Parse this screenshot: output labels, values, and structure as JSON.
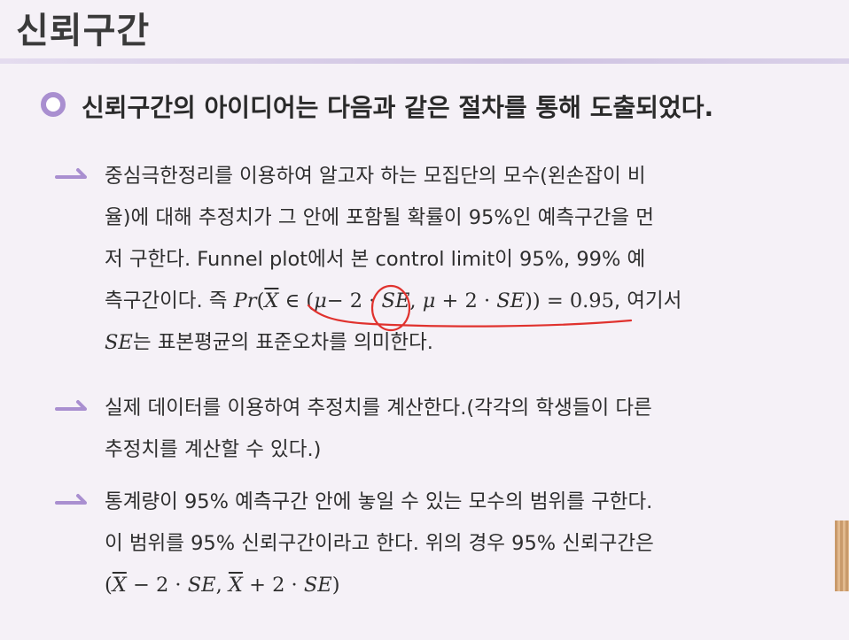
{
  "title": "신뢰구간",
  "heading": "신뢰구간의 아이디어는 다음과 같은 절차를 통해 도출되었다.",
  "items": [
    {
      "line1": "중심극한정리를 이용하여 알고자 하는 모집단의 모수(왼손잡이 비",
      "line2": "율)에 대해 추정치가 그 안에 포함될 확률이 95%인 예측구간을 먼",
      "line3": "저 구한다. Funnel plot에서 본 control limit이 95%, 99% 예",
      "line4_prefix": "측구간이다. 즉 ",
      "formula": {
        "pr": "Pr",
        "open": "(",
        "xbar": "X",
        "in": "∈",
        "open2": "(",
        "mu": "μ",
        "minus": "− 2 · ",
        "se": "SE",
        "comma": ", ",
        "mu2": "μ",
        "plus": " + 2 · ",
        "se2": "SE",
        "close": ")) = 0.95"
      },
      "line4_suffix": ", 여기서",
      "line5_se": "SE",
      "line5_rest": "는 표본평균의 표준오차를 의미한다."
    },
    {
      "line1": "실제 데이터를 이용하여 추정치를 계산한다.(각각의 학생들이 다른",
      "line2": "추정치를 계산할 수 있다.)"
    },
    {
      "line1": "통계량이 95% 예측구간 안에 놓일 수 있는 모수의 범위를 구한다.",
      "line2": "이 범위를 95% 신뢰구간이라고 한다. 위의 경우 95% 신뢰구간은",
      "ci": {
        "open": "(",
        "xbar": "X",
        "minus": " − 2 · ",
        "se": "SE",
        "comma": ", ",
        "xbar2": "X",
        "plus": " + 2 · ",
        "se2": "SE",
        "close": ")"
      }
    }
  ],
  "colors": {
    "accent": "#a98fd0",
    "annotation": "#e0322e"
  }
}
